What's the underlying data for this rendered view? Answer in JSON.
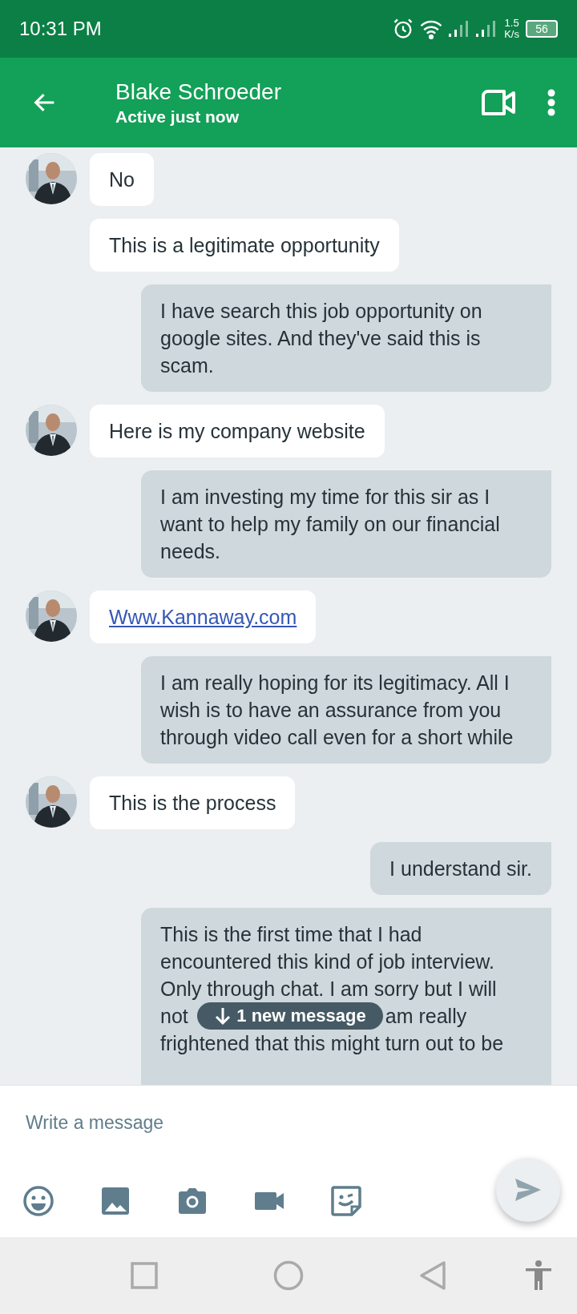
{
  "status_bar": {
    "time": "10:31 PM",
    "speed_value": "1.5",
    "speed_unit": "K/s",
    "battery": "56"
  },
  "header": {
    "name": "Blake Schroeder",
    "status": "Active just now"
  },
  "messages": [
    {
      "kind": "received",
      "avatar": true,
      "text": "No"
    },
    {
      "kind": "received",
      "avatar": false,
      "text": "This is a legitimate opportunity"
    },
    {
      "kind": "sent",
      "text": "I have search this job opportunity on google sites. And they've said this is scam."
    },
    {
      "kind": "received",
      "avatar": true,
      "text": "Here is my company website"
    },
    {
      "kind": "sent",
      "text": "I am investing my time for this sir as I want to help my family on our financial needs."
    },
    {
      "kind": "link",
      "avatar": true,
      "text": "Www.Kannaway.com"
    },
    {
      "kind": "sent",
      "text": "I am really hoping for its legitimacy. All I  wish is to have an assurance from you through video call even for a short while"
    },
    {
      "kind": "received",
      "avatar": true,
      "text": "This is the process"
    },
    {
      "kind": "sent",
      "text": "I understand sir."
    },
    {
      "kind": "covered",
      "lines": [
        [
          "This is the first time that I had"
        ],
        [
          "encountered this kind of job interview."
        ],
        [
          "Only through chat. I am sorry but I will"
        ],
        [
          "not",
          "am really"
        ],
        [
          "frightened that this might turn out to be"
        ]
      ]
    }
  ],
  "new_message_pill": "1 new message",
  "composer": {
    "placeholder": "Write a message"
  }
}
